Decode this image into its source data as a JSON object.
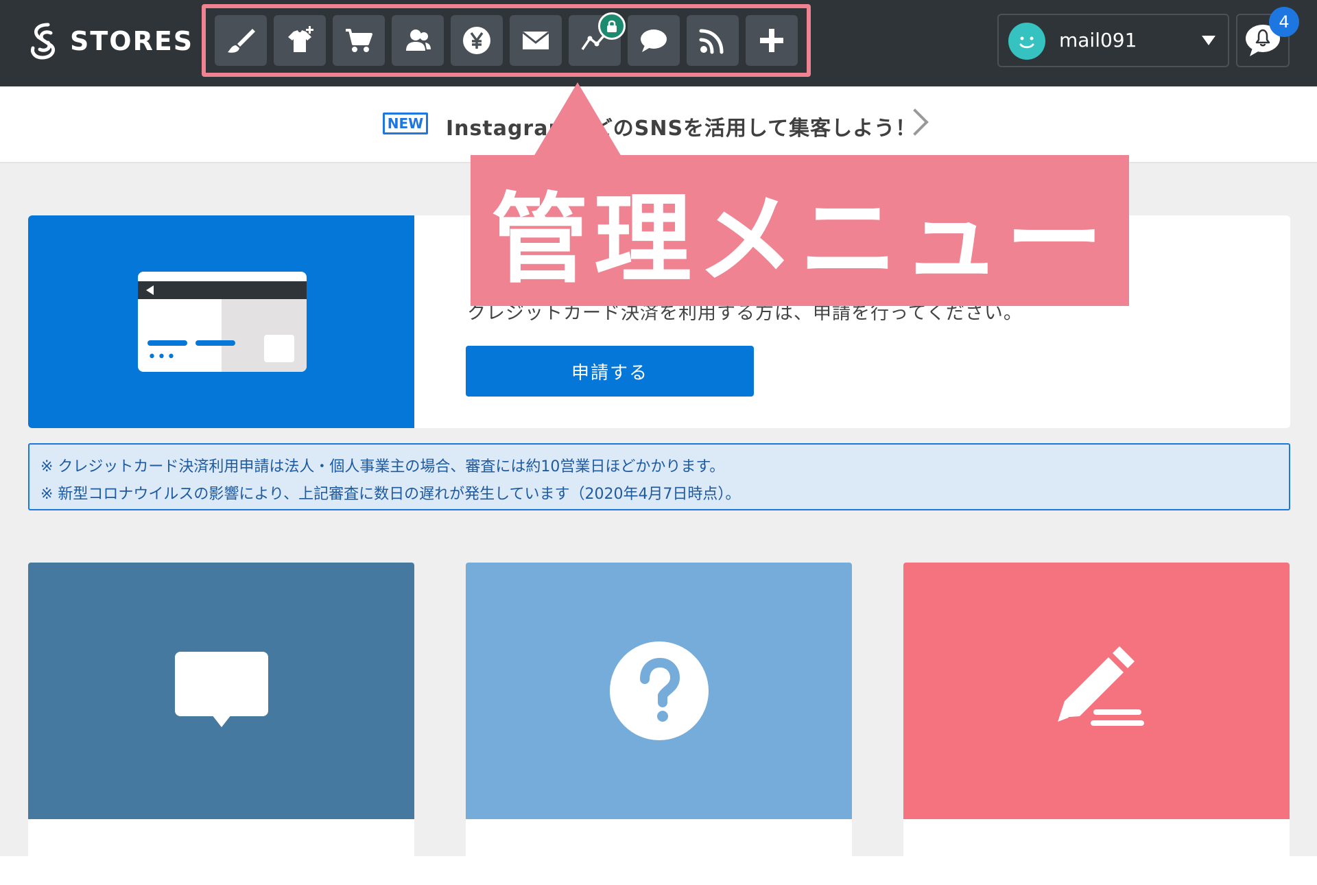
{
  "header": {
    "logo_text": "STORES",
    "menu_items": [
      {
        "icon": "brush-icon",
        "name": "design"
      },
      {
        "icon": "shirt-plus-icon",
        "name": "add-item"
      },
      {
        "icon": "cart-icon",
        "name": "orders"
      },
      {
        "icon": "customers-icon",
        "name": "customers"
      },
      {
        "icon": "yen-icon",
        "name": "payments"
      },
      {
        "icon": "mail-icon",
        "name": "mail"
      },
      {
        "icon": "analytics-icon",
        "name": "analytics",
        "locked": true
      },
      {
        "icon": "chat-icon",
        "name": "messages"
      },
      {
        "icon": "rss-icon",
        "name": "blog"
      },
      {
        "icon": "plus-icon",
        "name": "apps"
      }
    ],
    "account_name": "mail091",
    "notification_count": "4"
  },
  "announcement": {
    "badge": "NEW",
    "text": "InstagramなどのSNSを活用して集客しよう！"
  },
  "callout": {
    "text": "管理メニュー"
  },
  "credit_card_card": {
    "description": "クレジットカード決済を利用する方は、申請を行ってください。",
    "apply_button": "申請する"
  },
  "notice": {
    "line1": "※ クレジットカード決済利用申請は法人・個人事業主の場合、審査には約10営業日ほどかかります。",
    "line2": "※ 新型コロナウイルスの影響により、上記審査に数日の遅れが発生しています（2020年4月7日時点）。"
  },
  "tiles": [
    {
      "icon": "speech-bubble-icon",
      "color": "#45799f"
    },
    {
      "icon": "question-icon",
      "color": "#75acd9"
    },
    {
      "icon": "pencil-icon",
      "color": "#f5737f"
    }
  ],
  "colors": {
    "topbar": "#2f3439",
    "accent_blue": "#0577d8",
    "callout_pink": "#ef8392"
  }
}
